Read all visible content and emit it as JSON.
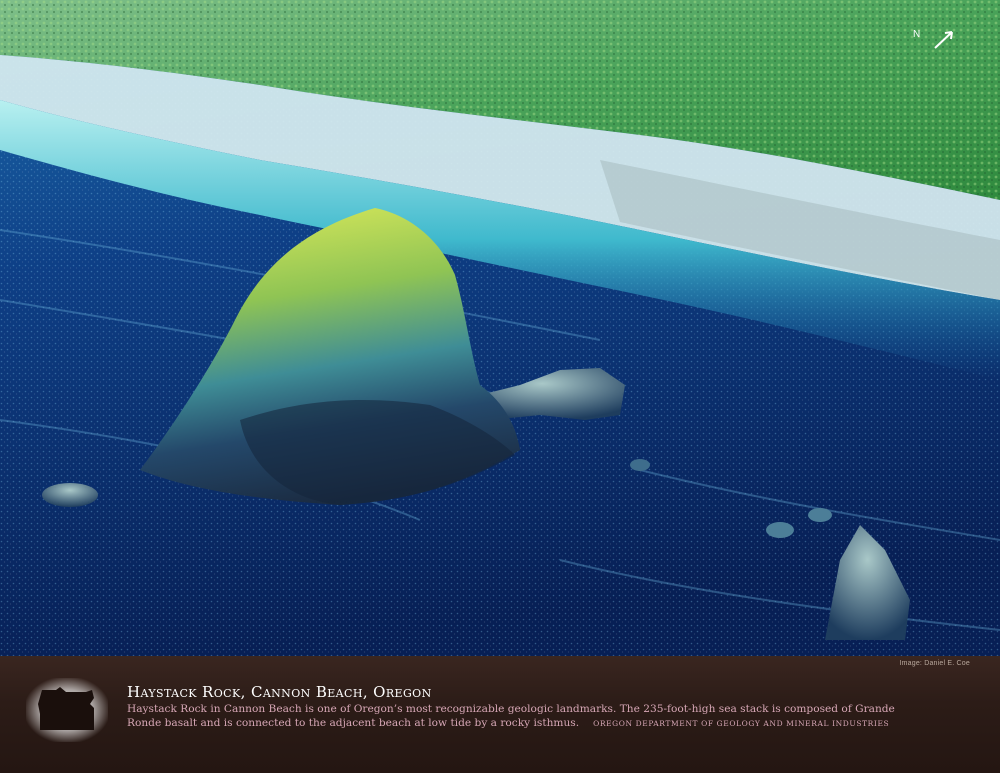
{
  "poster": {
    "title": "Haystack Rock, Cannon Beach, Oregon",
    "description": "Haystack Rock in Cannon Beach is one of Oregon’s most recognizable geologic landmarks. The 235-foot-high sea stack is composed of Grande Ronde basalt and is connected to the adjacent beach at low tide by a rocky isthmus.",
    "agency": "Oregon Department of Geology and Mineral Industries",
    "credit": "Image: Daniel E. Coe",
    "north_label": "N"
  },
  "colors": {
    "caption_background": "#2c1c17",
    "title": "#ffffff",
    "description_text": "#d7a7b6",
    "vegetation": "#5fae45",
    "beach": "#d9eef0",
    "shallow_water": "#3fb6c8",
    "deep_water": "#0b3a78",
    "rock_top": "#c8e04a",
    "rock_base": "#1a2f4a"
  }
}
